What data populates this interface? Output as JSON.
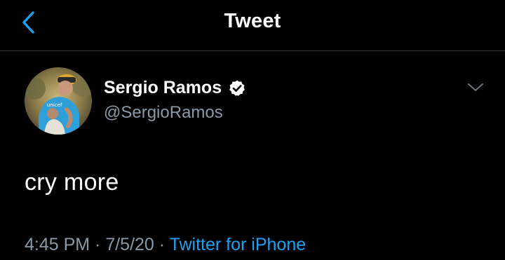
{
  "nav": {
    "title": "Tweet",
    "back_icon": "chevron-left-icon"
  },
  "tweet": {
    "author": {
      "display_name": "Sergio Ramos",
      "handle": "@SergioRamos",
      "verified": true,
      "verified_icon": "verified-badge-icon"
    },
    "more_icon": "chevron-down-icon",
    "text": "cry more",
    "meta": {
      "time": "4:45 PM",
      "separator_1": " · ",
      "date": "7/5/20",
      "separator_2": " · ",
      "source": "Twitter for iPhone"
    }
  },
  "colors": {
    "background": "#000000",
    "primary_text": "#ffffff",
    "secondary_text": "#8b98a5",
    "accent": "#1da1f2",
    "divider": "#2f3336"
  }
}
